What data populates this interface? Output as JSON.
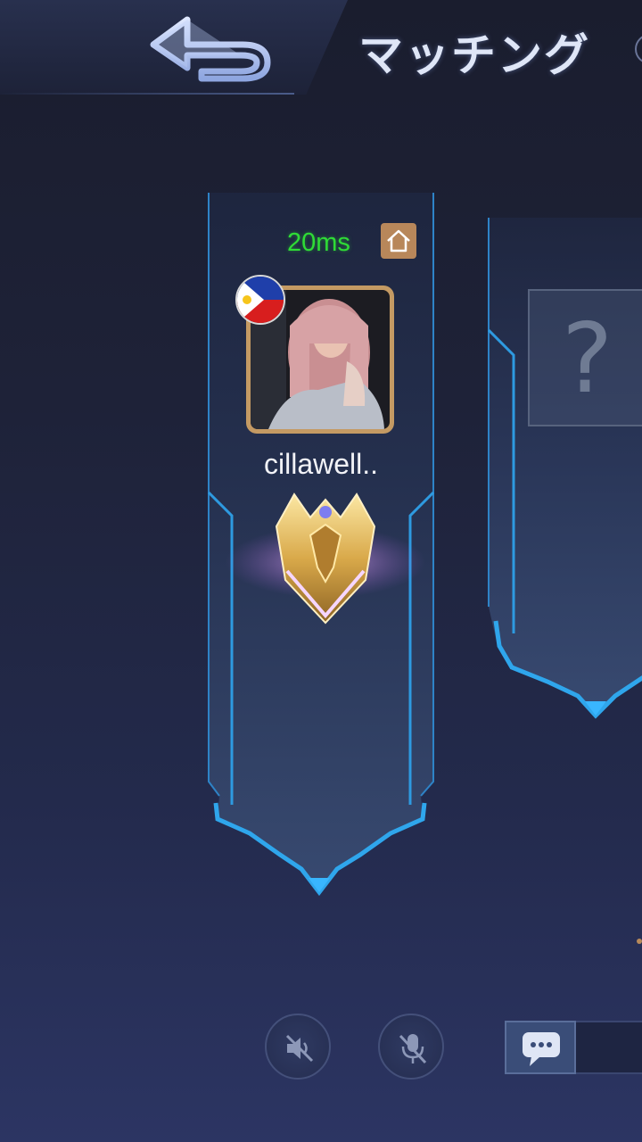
{
  "header": {
    "title": "マッチング",
    "back_icon": "back-arrow-icon"
  },
  "player": {
    "ping": "20ms",
    "name": "cillawell..",
    "country_flag": "philippines-flag-icon",
    "home_icon": "home-icon",
    "rank_icon": "mythic-rank-emblem-icon",
    "ping_color": "#2fdc36"
  },
  "empty_slot": {
    "placeholder": "?"
  },
  "controls": {
    "speaker_icon": "speaker-muted-icon",
    "mic_icon": "microphone-muted-icon",
    "chat_icon": "chat-bubble-icon"
  }
}
